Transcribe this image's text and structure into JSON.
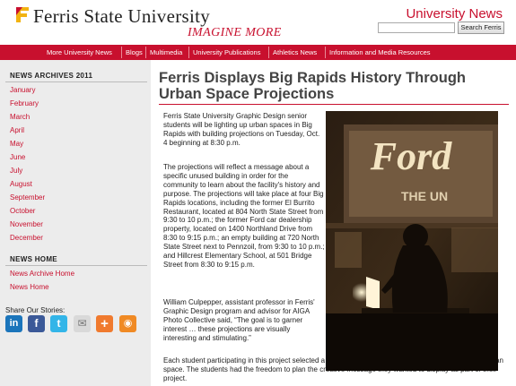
{
  "header": {
    "brand": "Ferris State University",
    "tagline": "IMAGINE MORE",
    "site_title": "University News",
    "search_button": "Search Ferris",
    "search_value": ""
  },
  "nav": {
    "items": [
      "More University News",
      "Blogs",
      "Multimedia",
      "University Publications",
      "Athletics News",
      "Information and Media Resources"
    ]
  },
  "sidebar": {
    "archives_title": "NEWS ARCHIVES 2011",
    "months": [
      "January",
      "February",
      "March",
      "April",
      "May",
      "June",
      "July",
      "August",
      "September",
      "October",
      "November",
      "December"
    ],
    "home_title": "NEWS HOME",
    "home_links": [
      "News Archive Home",
      "News Home"
    ],
    "share_title": "Share Our Stories:",
    "share_icons": [
      {
        "name": "linkedin",
        "glyph": "in",
        "color": "#1b75bb"
      },
      {
        "name": "facebook",
        "glyph": "f",
        "color": "#3b5998"
      },
      {
        "name": "twitter",
        "glyph": "t",
        "color": "#33b5e8"
      },
      {
        "name": "email",
        "glyph": "✉",
        "color": "#d9d9d9"
      },
      {
        "name": "add",
        "glyph": "+",
        "color": "#f07a2e"
      },
      {
        "name": "rss",
        "glyph": "◉",
        "color": "#f08a24"
      }
    ]
  },
  "article": {
    "title": "Ferris Displays Big Rapids History Through Urban Space Projections",
    "paragraphs": [
      "Ferris State University Graphic Design senior students will be lighting up urban spaces in Big Rapids with building projections on Tuesday, Oct. 4 beginning at 8:30 p.m.",
      "The projections will reflect a message about a specific unused building in order for the community to learn about the facility's history and purpose. The projections will take place at four Big Rapids locations, including the former El Burrito Restaurant, located at 804 North State Street from 9:30 to 10 p.m.; the former Ford car dealership property, located on 1400 Northland Drive from 8:30 to 9:15 p.m.; an empty building at 720 North State Street next to Pennzoil, from 9:30 to 10 p.m.; and Hillcrest Elementary School, at 501 Bridge Street from 8:30 to 9:15 p.m.",
      "William Culpepper, assistant professor in Ferris' Graphic Design program and advisor for AIGA Photo Collective said, “The goal is to garner interest … these projections are visually interesting and stimulating.”",
      "Each student participating in this project selected a building and researched the history of the current urban space. The students had the freedom to plan the creative message they wanted to display as part of their project."
    ],
    "photo_text": {
      "sign": "Ford",
      "sub": "THE UN"
    }
  },
  "colors": {
    "accent": "#c8102e",
    "sidebar_bg": "#ececec",
    "logo_yellow": "#f2b311"
  }
}
